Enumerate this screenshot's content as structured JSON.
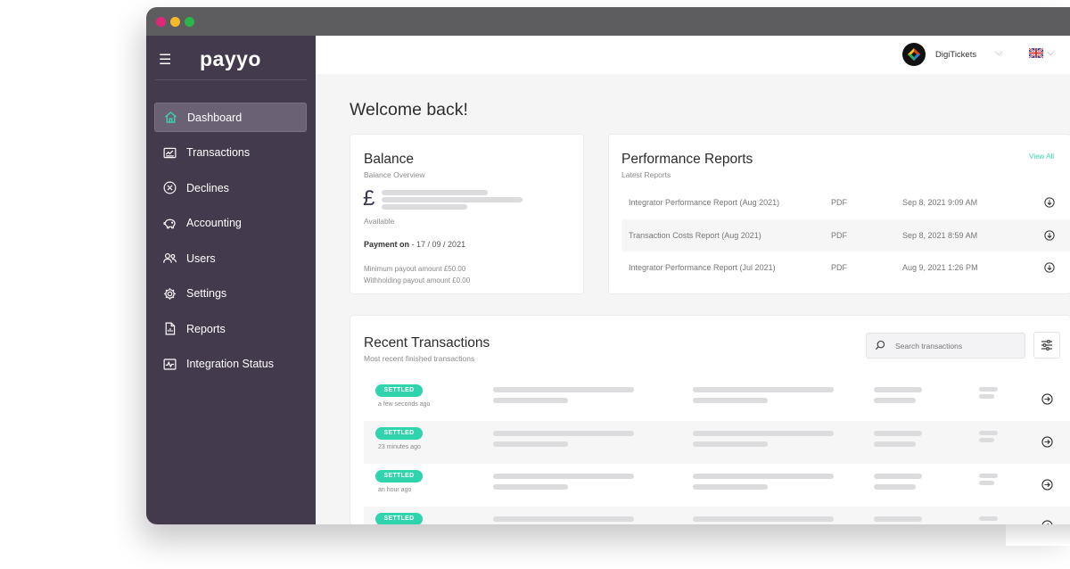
{
  "brand": {
    "logo": "payyo"
  },
  "sidebar": {
    "items": [
      {
        "label": "Dashboard",
        "icon": "home-icon",
        "active": true
      },
      {
        "label": "Transactions",
        "icon": "transactions-icon"
      },
      {
        "label": "Declines",
        "icon": "circle-x-icon"
      },
      {
        "label": "Accounting",
        "icon": "piggy-bank-icon"
      },
      {
        "label": "Users",
        "icon": "users-icon"
      },
      {
        "label": "Settings",
        "icon": "gear-icon"
      },
      {
        "label": "Reports",
        "icon": "report-file-icon"
      },
      {
        "label": "Integration Status",
        "icon": "activity-chart-icon"
      }
    ]
  },
  "topbar": {
    "account_name": "DigiTickets",
    "language_flag": "uk-flag-icon"
  },
  "main": {
    "welcome": "Welcome back!"
  },
  "balance": {
    "title": "Balance",
    "subtitle": "Balance Overview",
    "currency_symbol": "£",
    "available_label": "Available",
    "payment_on_label": "Payment on",
    "payment_on_date": "- 17 / 09 / 2021",
    "min_payout": "Minimum payout amount £50.00",
    "withholding_payout": "Withholding payout amount £0.00"
  },
  "performance": {
    "title": "Performance Reports",
    "subtitle": "Latest Reports",
    "view_all": "View All",
    "reports": [
      {
        "name": "Integrator Performance Report (Aug 2021)",
        "format": "PDF",
        "date": "Sep 8, 2021 9:09 AM"
      },
      {
        "name": "Transaction Costs Report (Aug 2021)",
        "format": "PDF",
        "date": "Sep 8, 2021 8:59 AM"
      },
      {
        "name": "Integrator Performance Report (Jul 2021)",
        "format": "PDF",
        "date": "Aug 9, 2021 1:26 PM"
      }
    ]
  },
  "recent": {
    "title": "Recent Transactions",
    "subtitle": "Most recent finished transactions",
    "search_placeholder": "Search transactions",
    "transactions": [
      {
        "status": "SETTLED",
        "time": "a few seconds ago"
      },
      {
        "status": "SETTLED",
        "time": "23 minutes ago"
      },
      {
        "status": "SETTLED",
        "time": "an hour ago"
      },
      {
        "status": "SETTLED",
        "time": ""
      }
    ]
  },
  "colors": {
    "sidebar_bg": "#433a4d",
    "accent": "#2fd4ad",
    "home_icon": "#3bd2b0"
  }
}
